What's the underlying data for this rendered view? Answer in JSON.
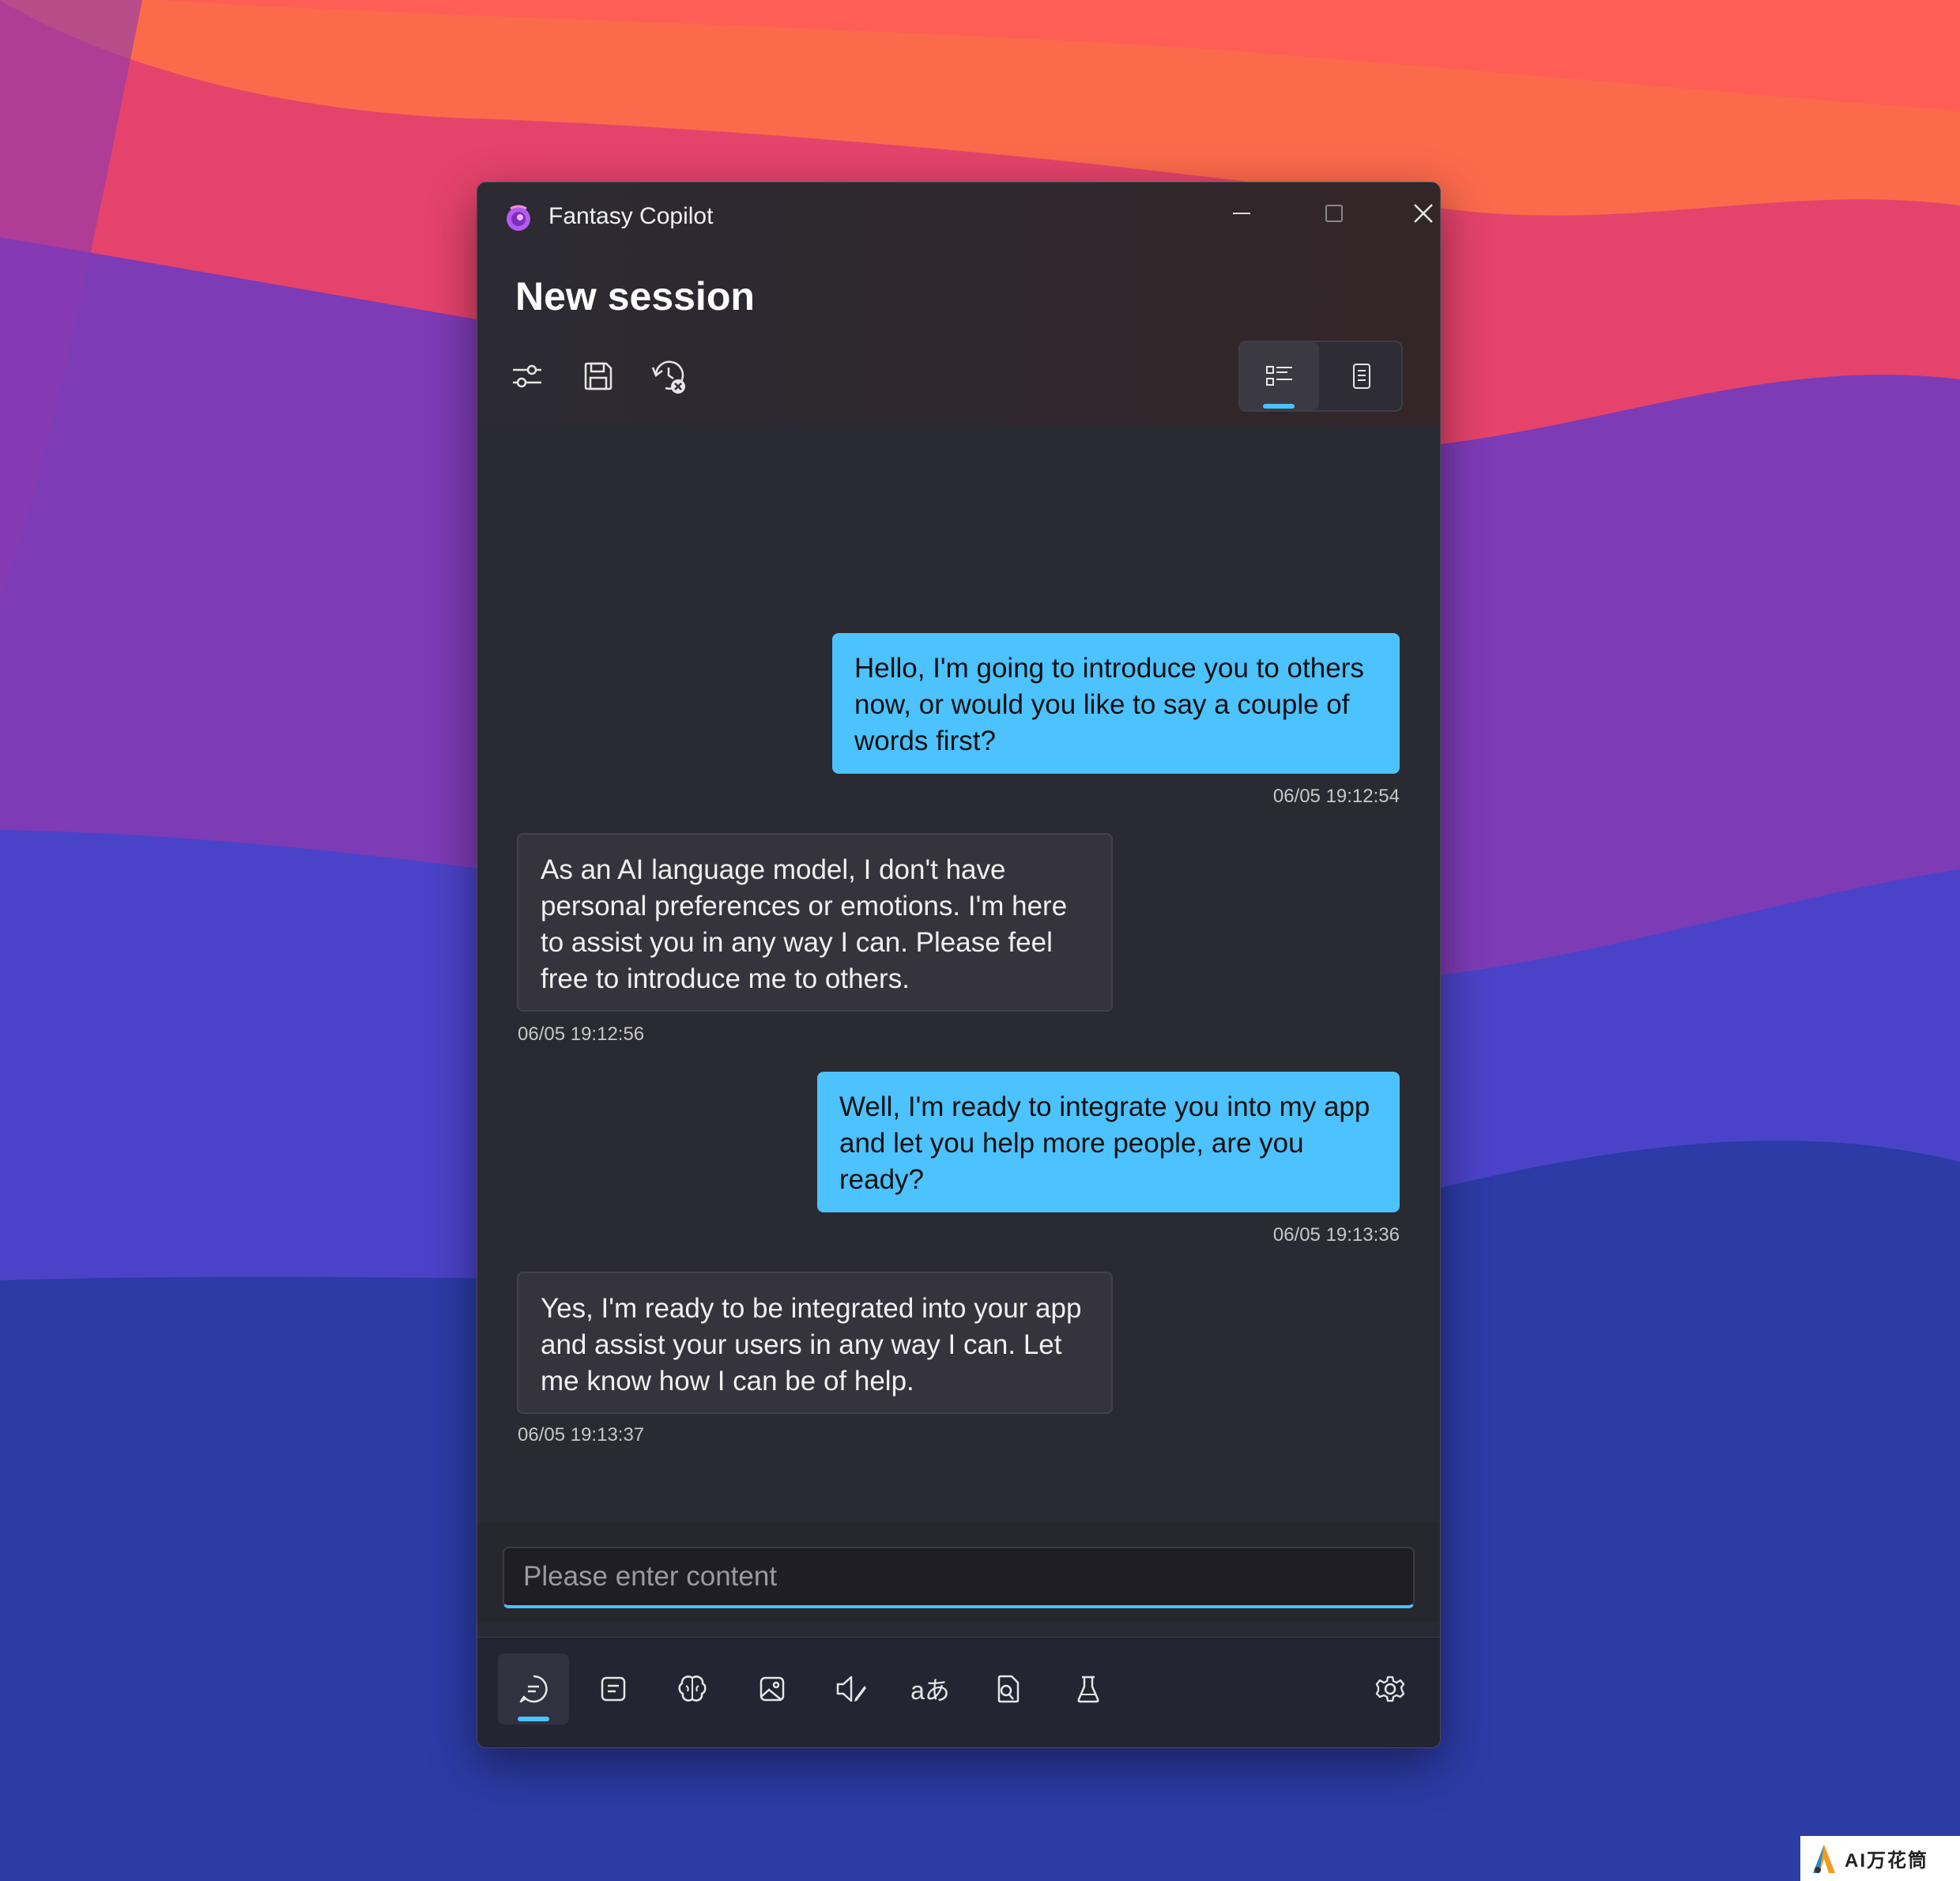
{
  "window": {
    "title": "Fantasy Copilot",
    "controls": {
      "minimize": "minimize-icon",
      "maximize": "maximize-icon",
      "close": "close-icon"
    }
  },
  "header": {
    "page_title": "New session",
    "tools": [
      "sliders-icon",
      "save-icon",
      "history-clear-icon"
    ],
    "view_toggle": {
      "active": "list-view",
      "options": [
        "list-view-icon",
        "document-view-icon"
      ]
    }
  },
  "messages": [
    {
      "role": "user",
      "text": "Hello, I'm going to introduce you to others now, or would you like to say a couple of words first?",
      "time": "06/05 19:12:54"
    },
    {
      "role": "assistant",
      "text": "As an AI language model, I don't have personal preferences or emotions. I'm here to assist you in any way I can. Please feel free to introduce me to others.",
      "time": "06/05 19:12:56"
    },
    {
      "role": "user",
      "text": "Well, I'm ready to integrate you into my app and let you help more people, are you ready?",
      "time": "06/05 19:13:36"
    },
    {
      "role": "assistant",
      "text": "Yes, I'm ready to be integrated into your app and assist your users in any way I can. Let me know how I can be of help.",
      "time": "06/05 19:13:37"
    }
  ],
  "input": {
    "placeholder": "Please enter content",
    "value": ""
  },
  "nav": {
    "active": "chat",
    "items": [
      "chat-icon",
      "notes-icon",
      "brain-icon",
      "image-icon",
      "speaker-icon",
      "translate-icon",
      "document-search-icon",
      "lab-flask-icon"
    ],
    "settings": "settings-icon",
    "translate_glyph": "aあ"
  },
  "watermark": {
    "text": "AI万花筒"
  },
  "colors": {
    "accent": "#4cc2ff",
    "window_bg": "#2a2a32",
    "user_bubble": "#4cc2ff",
    "ai_bubble": "#35343d"
  }
}
